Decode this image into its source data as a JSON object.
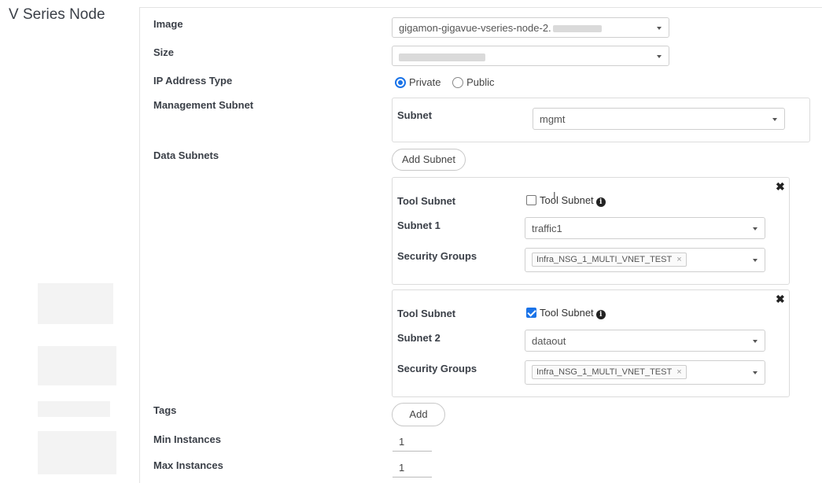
{
  "page": {
    "title": "V Series Node"
  },
  "labels": {
    "image": "Image",
    "size": "Size",
    "ip_address_type": "IP Address Type",
    "management_subnet": "Management Subnet",
    "data_subnets": "Data Subnets",
    "tags": "Tags",
    "min_instances": "Min Instances",
    "max_instances": "Max Instances"
  },
  "image_select": {
    "value": "gigamon-gigavue-vseries-node-2."
  },
  "ip_type": {
    "options": [
      "Private",
      "Public"
    ],
    "selected": "Private"
  },
  "management": {
    "subnet_label": "Subnet",
    "subnet_value": "mgmt"
  },
  "buttons": {
    "add_subnet": "Add Subnet",
    "add_tag": "Add"
  },
  "data_subnet_cards": [
    {
      "tool_subnet_label": "Tool Subnet",
      "checkbox_label": "Tool Subnet",
      "checked": false,
      "subnet_label": "Subnet 1",
      "subnet_value": "traffic1",
      "security_groups_label": "Security Groups",
      "security_group_tag": "Infra_NSG_1_MULTI_VNET_TEST",
      "remove_glyph": "×"
    },
    {
      "tool_subnet_label": "Tool Subnet",
      "checkbox_label": "Tool Subnet",
      "checked": true,
      "subnet_label": "Subnet 2",
      "subnet_value": "dataout",
      "security_groups_label": "Security Groups",
      "security_group_tag": "Infra_NSG_1_MULTI_VNET_TEST",
      "remove_glyph": "×"
    }
  ],
  "card_close_glyph": "✖",
  "info_glyph": "i",
  "min_instances_value": "1",
  "max_instances_value": "1",
  "colors": {
    "accent": "#1a73e8",
    "label": "#3a3f47",
    "border": "#cfcfcf"
  }
}
